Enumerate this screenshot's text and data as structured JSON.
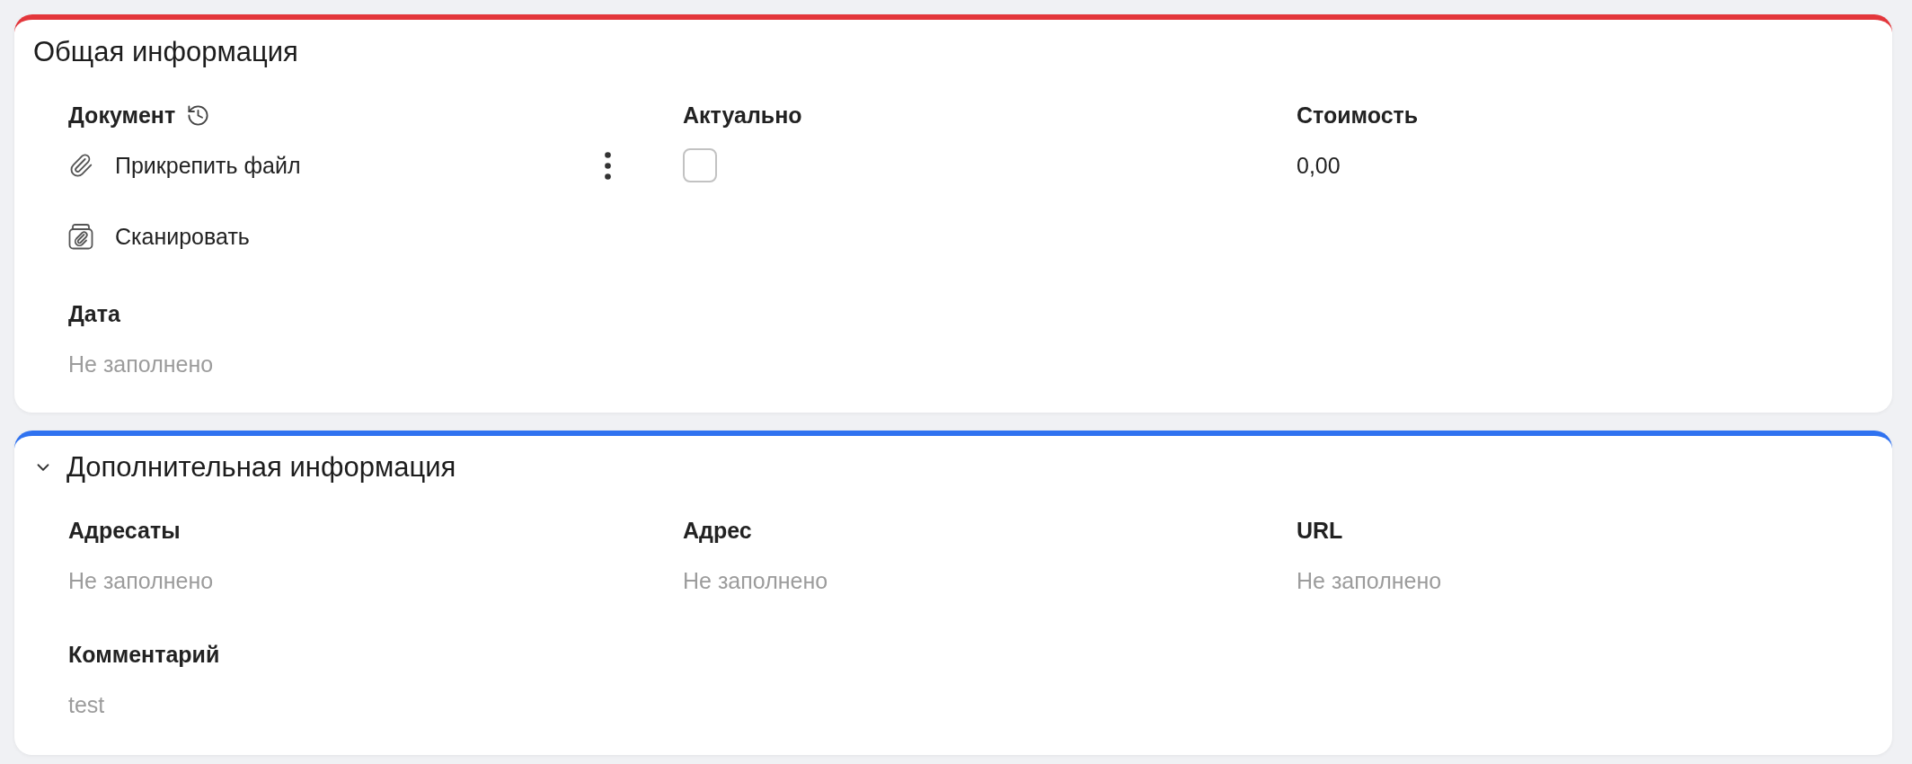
{
  "sections": [
    {
      "kind": "static",
      "title": "Общая информация",
      "color": "#e3363b",
      "fields": [
        {
          "kind": "document",
          "label": "Документ",
          "actions": [
            {
              "kind": "attach",
              "label": "Прикрепить файл",
              "has_menu": true
            },
            {
              "kind": "scan",
              "label": "Сканировать",
              "has_menu": false
            }
          ]
        },
        {
          "kind": "checkbox",
          "label": "Актуально",
          "checked": false
        },
        {
          "kind": "text",
          "label": "Стоимость",
          "value": "0,00",
          "empty": false
        },
        {
          "kind": "text",
          "label": "Дата",
          "value": "Не заполнено",
          "empty": true
        }
      ]
    },
    {
      "kind": "collapsible",
      "title": "Дополнительная информация",
      "color": "#2f72f0",
      "expanded": true,
      "fields": [
        {
          "kind": "text",
          "label": "Адресаты",
          "value": "Не заполнено",
          "empty": true
        },
        {
          "kind": "text",
          "label": "Адрес",
          "value": "Не заполнено",
          "empty": true
        },
        {
          "kind": "text",
          "label": "URL",
          "value": "Не заполнено",
          "empty": true
        },
        {
          "kind": "note",
          "label": "Комментарий",
          "value": "test"
        }
      ]
    }
  ]
}
